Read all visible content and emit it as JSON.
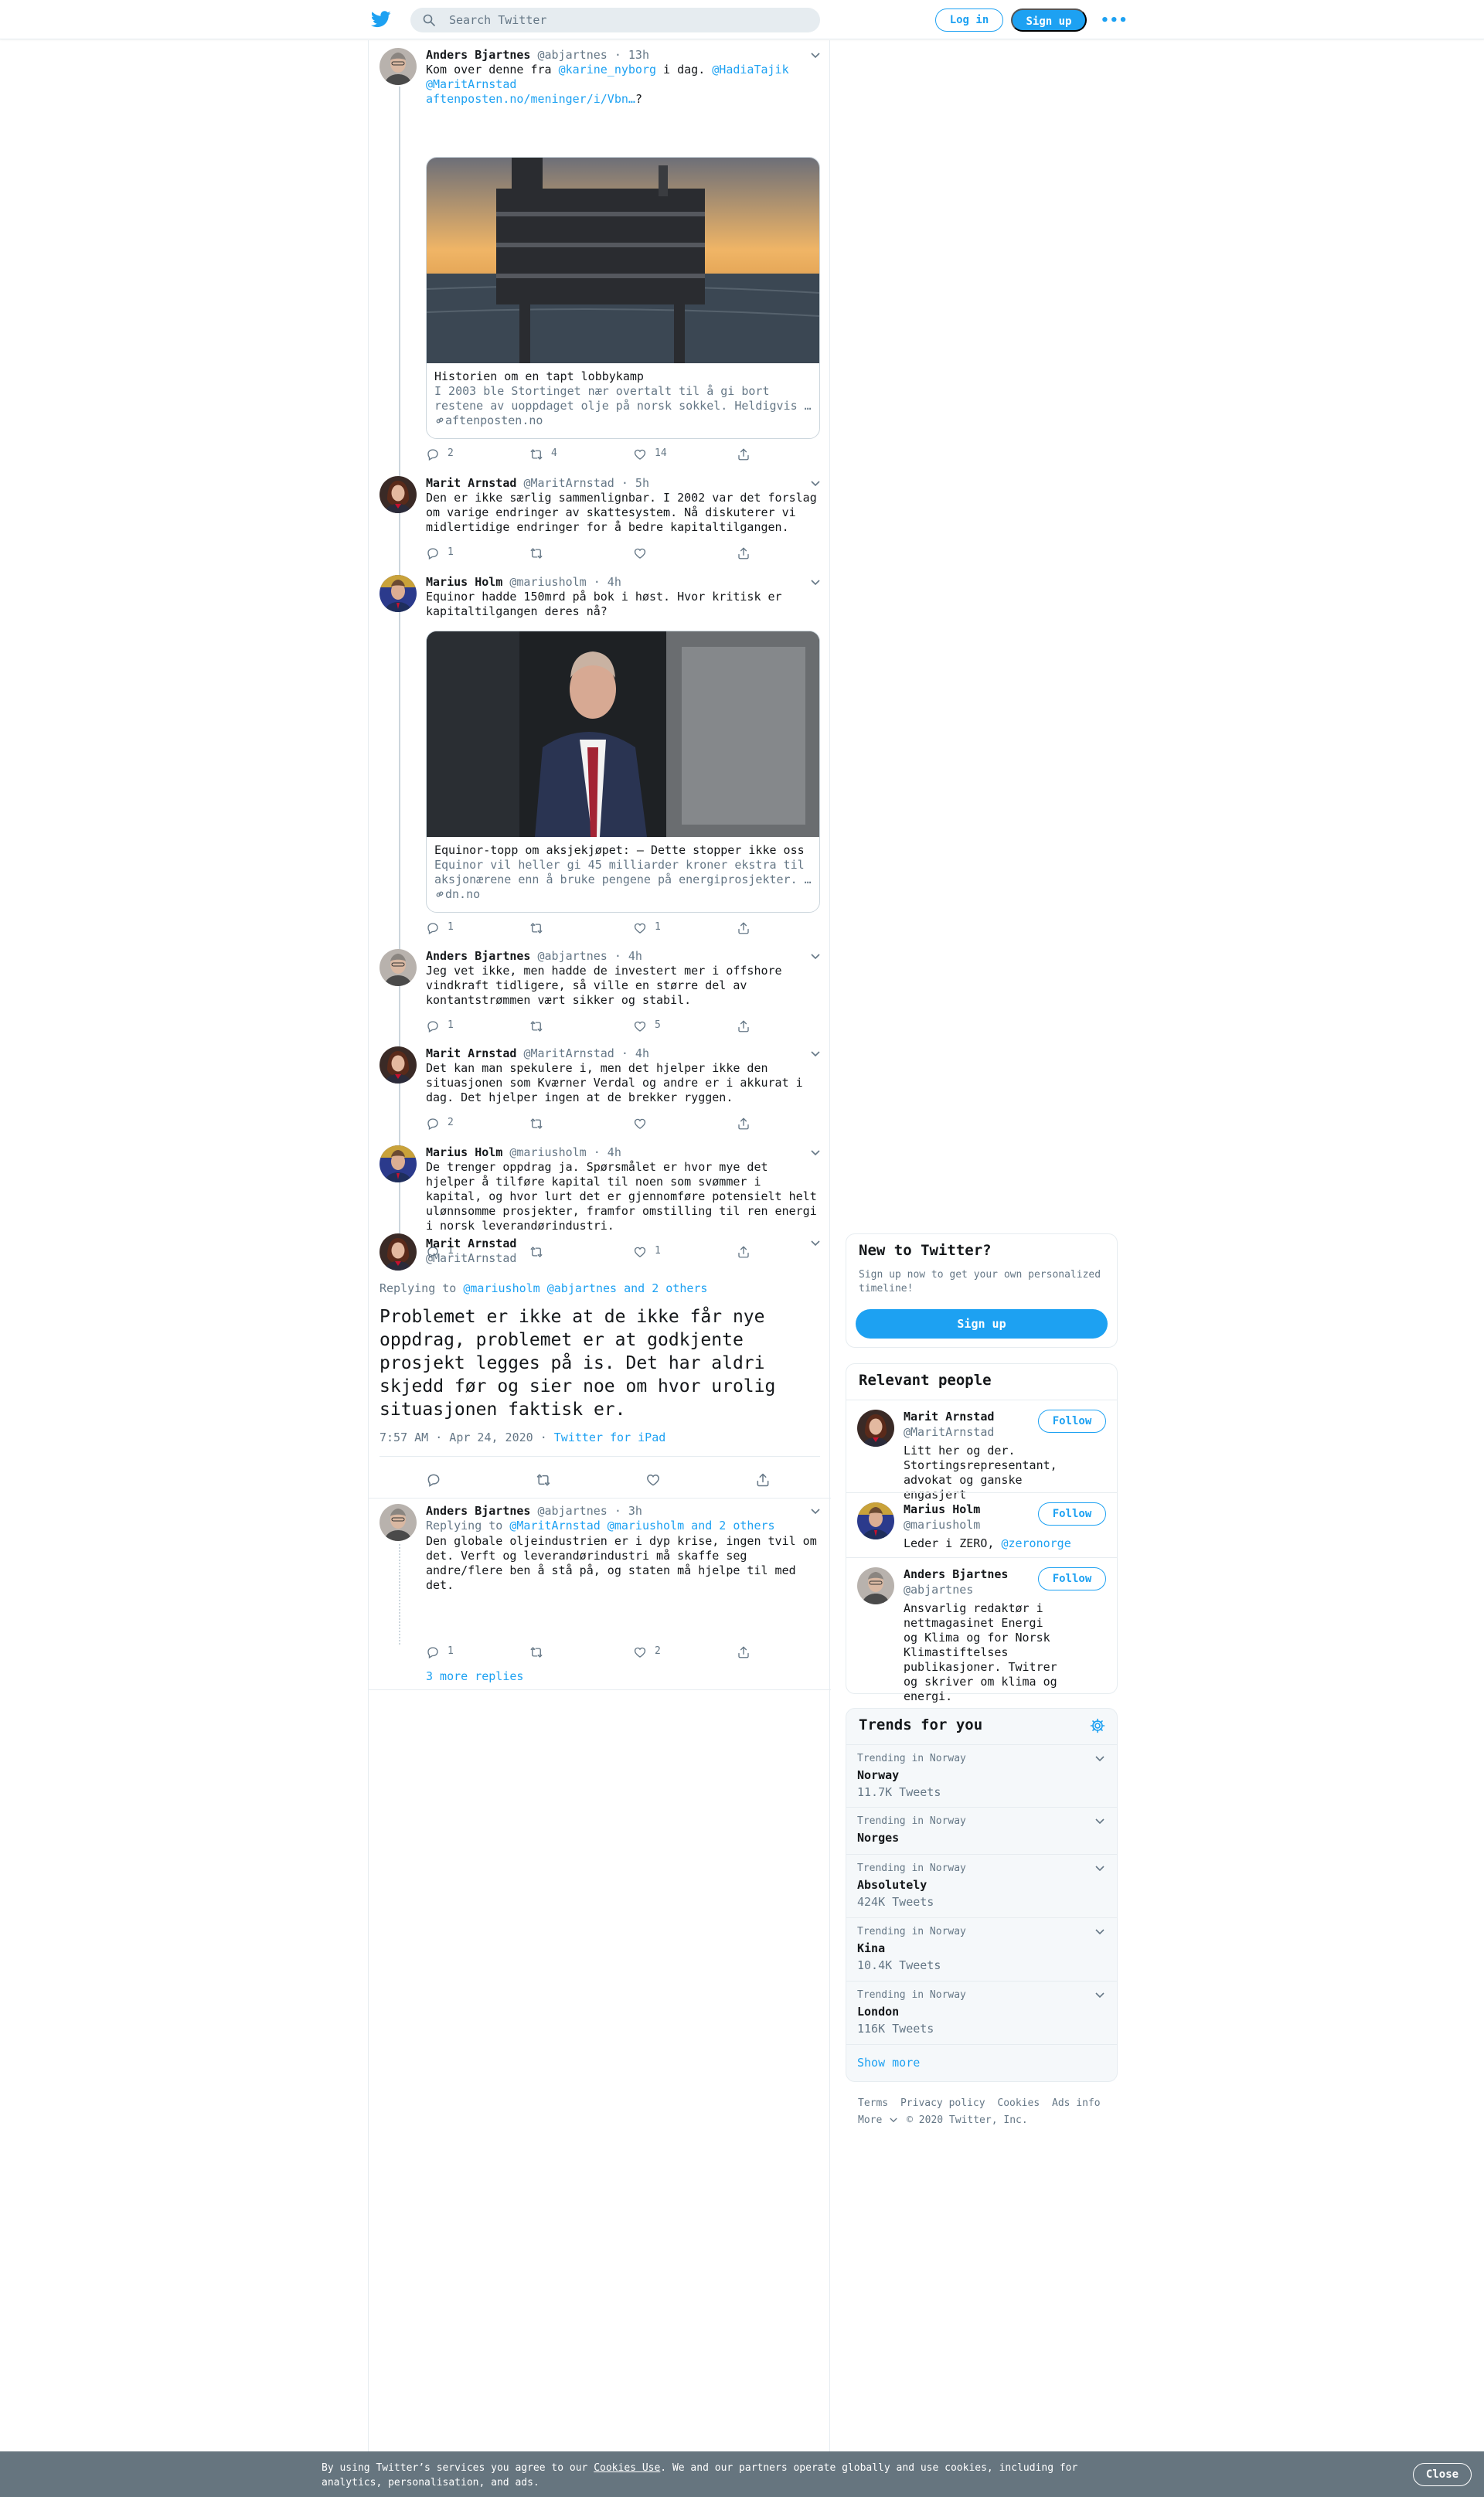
{
  "header": {
    "search_placeholder": "Search Twitter",
    "login_label": "Log in",
    "signup_label": "Sign up",
    "more_label": "•••"
  },
  "tweets": [
    {
      "name": "Anders Bjartnes",
      "handle": "@abjartnes",
      "time": "· 13h",
      "text_pre": "Kom over denne fra ",
      "mention1": "@karine_nyborg",
      "text_mid": " i dag. ",
      "mention2": "@HadiaTajik",
      "mention3": "@MaritArnstad",
      "link": "aftenposten.no/meninger/i/Vbn…",
      "text_post": "?",
      "card": {
        "title": "Historien om en tapt lobbykamp",
        "desc": "I 2003 ble Stortinget nær overtalt til å gi bort restene av uoppdaget olje på norsk sokkel. Heldigvis …",
        "domain": "aftenposten.no"
      },
      "replies": "2",
      "retweets": "4",
      "likes": "14"
    },
    {
      "name": "Marit Arnstad",
      "handle": "@MaritArnstad",
      "time": "· 5h",
      "text": "Den er ikke særlig sammenlignbar. I 2002 var det forslag om varige endringer av skattesystem. Nå diskuterer vi midlertidige endringer for å bedre kapitaltilgangen.",
      "replies": "1",
      "retweets": "",
      "likes": ""
    },
    {
      "name": "Marius Holm",
      "handle": "@mariusholm",
      "time": "· 4h",
      "text": "Equinor hadde 150mrd på bok i høst. Hvor kritisk er kapitaltilgangen deres nå?",
      "card": {
        "title": "Equinor-topp om aksjekjøpet: – Dette stopper ikke oss",
        "desc": "Equinor vil heller gi 45 milliarder kroner ekstra til aksjonærene enn å bruke pengene på energiprosjekter. …",
        "domain": "dn.no"
      },
      "replies": "1",
      "retweets": "",
      "likes": "1"
    },
    {
      "name": "Anders Bjartnes",
      "handle": "@abjartnes",
      "time": "· 4h",
      "text": "Jeg vet ikke, men hadde de investert mer i offshore vindkraft tidligere, så ville en større del av kontantstrømmen vært sikker og stabil.",
      "replies": "1",
      "retweets": "",
      "likes": "5"
    },
    {
      "name": "Marit Arnstad",
      "handle": "@MaritArnstad",
      "time": "· 4h",
      "text": "Det kan man spekulere i, men det hjelper ikke den situasjonen som Kværner Verdal og andre er i akkurat i dag. Det hjelper ingen at de brekker ryggen.",
      "replies": "2",
      "retweets": "",
      "likes": ""
    },
    {
      "name": "Marius Holm",
      "handle": "@mariusholm",
      "time": "· 4h",
      "text": "De trenger oppdrag ja. Spørsmålet er hvor mye det hjelper å tilføre kapital til noen som svømmer i kapital, og hvor lurt det er gjennomføre potensielt helt ulønnsomme prosjekter, framfor omstilling til ren energi i norsk leverandørindustri.",
      "replies": "1",
      "retweets": "",
      "likes": "1"
    }
  ],
  "focus": {
    "name": "Marit Arnstad",
    "handle": "@MaritArnstad",
    "replying_label": "Replying to ",
    "replying_mentions": "@mariusholm @abjartnes and 2 others",
    "text": "Problemet er ikke at de ikke får nye oppdrag, problemet er at godkjente prosjekt legges på is. Det har aldri skjedd før og sier noe om hvor urolig situasjonen faktisk er.",
    "timestamp": "7:57 AM · Apr 24, 2020 · ",
    "source": "Twitter for iPad"
  },
  "reply": {
    "name": "Anders Bjartnes",
    "handle": "@abjartnes",
    "time": "· 3h",
    "replying_label": "Replying to ",
    "replying_mentions": "@MaritArnstad @mariusholm and 2 others",
    "text": "Den globale oljeindustrien er i dyp krise, ingen tvil om det. Verft og leverandørindustri må skaffe seg andre/flere ben å stå på, og staten må hjelpe til med det.",
    "replies": "1",
    "retweets": "",
    "likes": "2",
    "more_replies": "3 more replies"
  },
  "sidebar": {
    "new_title": "New to Twitter?",
    "new_sub": "Sign up now to get your own personalized timeline!",
    "new_signup": "Sign up",
    "relevant_title": "Relevant people",
    "people": [
      {
        "name": "Marit Arnstad",
        "handle": "@MaritArnstad",
        "bio": "Litt her og der. Stortingsrepresentant, advokat og ganske engasjert",
        "follow": "Follow"
      },
      {
        "name": "Marius Holm",
        "handle": "@mariusholm",
        "bio_pre": "Leder i ZERO, ",
        "bio_link": "@zeronorge",
        "follow": "Follow"
      },
      {
        "name": "Anders Bjartnes",
        "handle": "@abjartnes",
        "bio": "Ansvarlig redaktør i nettmagasinet Energi og Klima og for Norsk Klimastiftelses publikasjoner. Twitrer og skriver om klima og energi.",
        "follow": "Follow"
      }
    ],
    "trends_title": "Trends for you",
    "trends": [
      {
        "context": "Trending in Norway",
        "name": "Norway",
        "count": "11.7K Tweets"
      },
      {
        "context": "Trending in Norway",
        "name": "Norges",
        "count": ""
      },
      {
        "context": "Trending in Norway",
        "name": "Absolutely",
        "count": "424K Tweets"
      },
      {
        "context": "Trending in Norway",
        "name": "Kina",
        "count": "10.4K Tweets"
      },
      {
        "context": "Trending in Norway",
        "name": "London",
        "count": "116K Tweets"
      }
    ],
    "show_more": "Show more"
  },
  "footer": {
    "terms": "Terms",
    "privacy": "Privacy policy",
    "cookies": "Cookies",
    "ads": "Ads info",
    "more": "More",
    "copyright": "© 2020 Twitter, Inc."
  },
  "cookie_bar": {
    "text_pre": "By using Twitter’s services you agree to our ",
    "link": "Cookies Use",
    "text_post": ". We and our partners operate globally and use cookies, including for analytics, personalisation, and ads.",
    "close": "Close"
  },
  "colors": {
    "accent": "#1da1f2",
    "secondary_text": "#657786",
    "border": "#e6ecf0",
    "cookie_bg": "#66757f"
  }
}
